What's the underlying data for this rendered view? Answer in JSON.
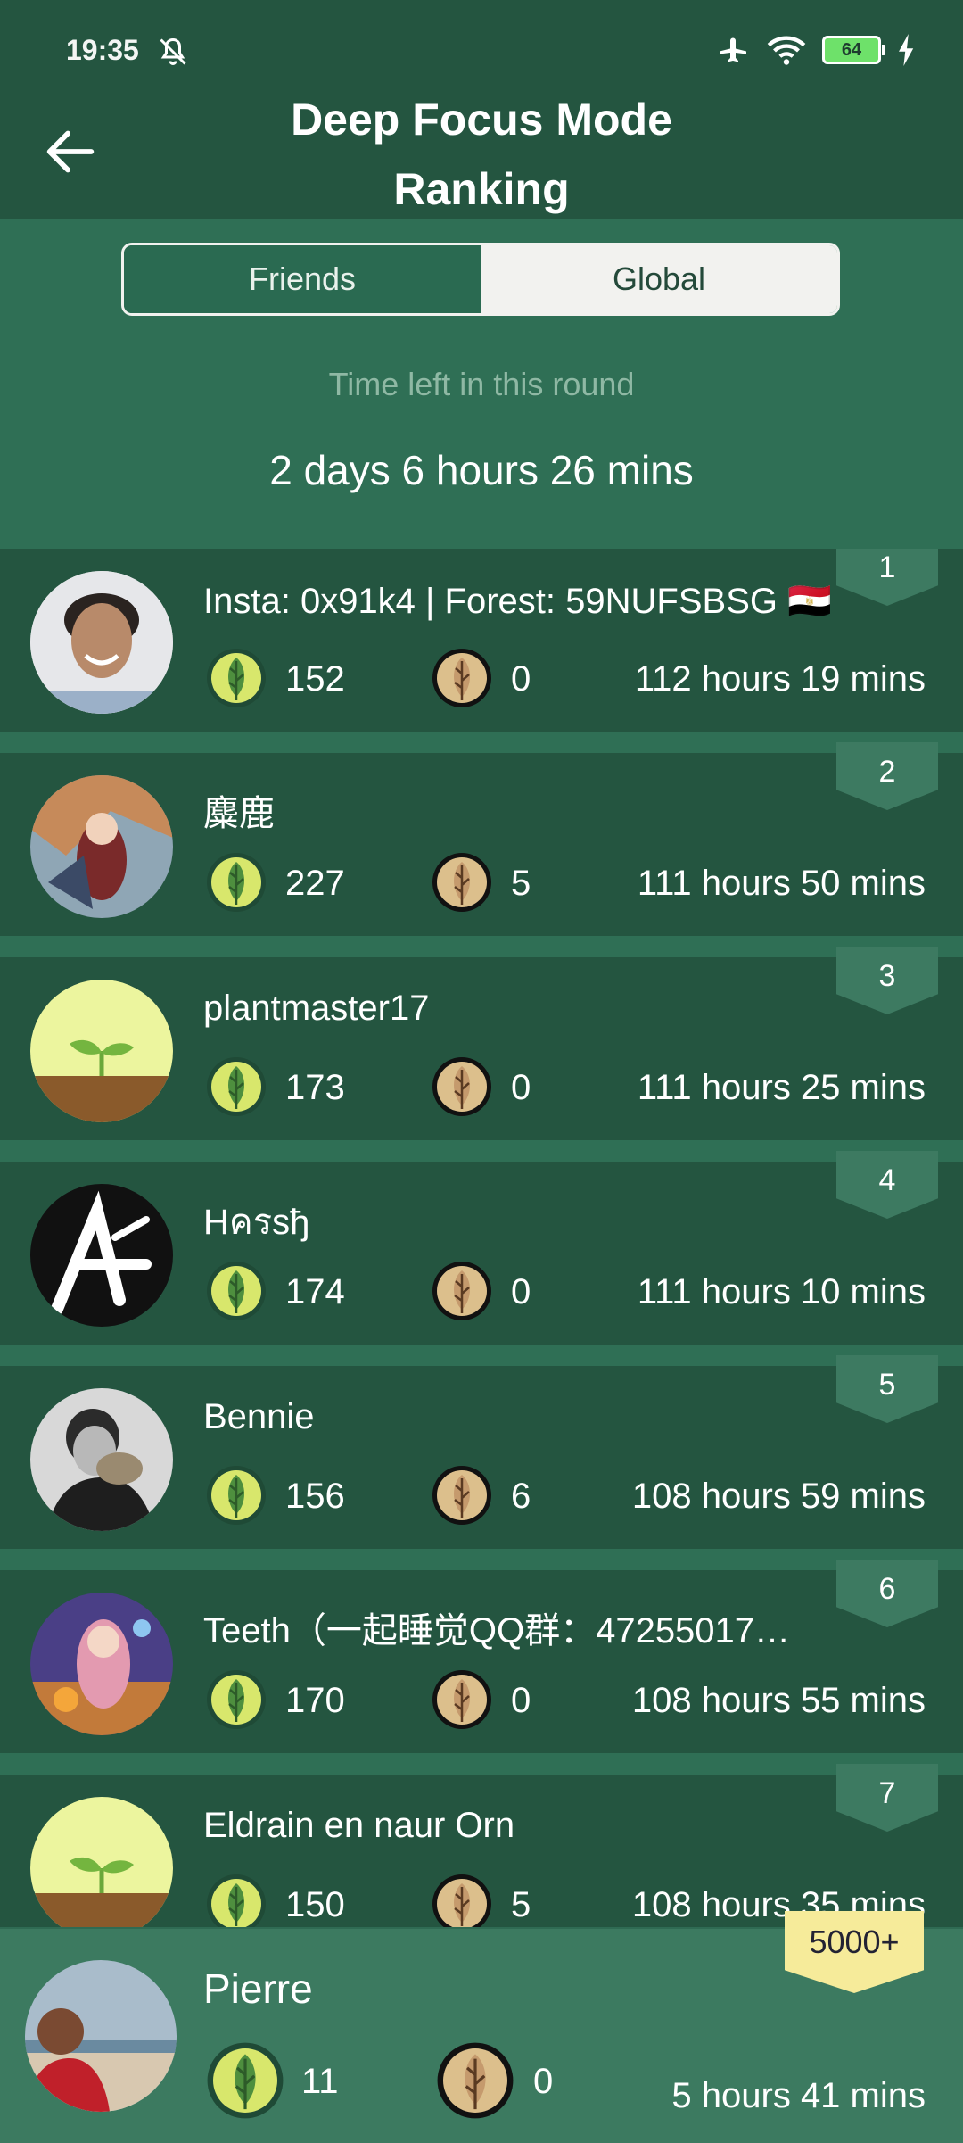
{
  "status_bar": {
    "time": "19:35",
    "battery": "64",
    "icons": [
      "bell-off-icon",
      "airplane-icon",
      "wifi-icon",
      "battery-icon",
      "charging-icon"
    ]
  },
  "header": {
    "title_line1": "Deep Focus Mode",
    "title_line2": "Ranking",
    "back_icon": "arrow-left-icon"
  },
  "tabs": {
    "friends": "Friends",
    "global": "Global",
    "selected": "global"
  },
  "round": {
    "label": "Time left in this round",
    "value": "2 days 6 hours 26 mins"
  },
  "rankings": [
    {
      "rank": "1",
      "name": "Insta: 0x91k4 | Forest: 59NUFSBSG 🇪🇬",
      "green": "152",
      "brown": "0",
      "time": "112 hours 19 mins",
      "avatar": "photo-man"
    },
    {
      "rank": "2",
      "name": "麋鹿",
      "green": "227",
      "brown": "5",
      "time": "111 hours 50 mins",
      "avatar": "anime-art"
    },
    {
      "rank": "3",
      "name": "plantmaster17",
      "green": "173",
      "brown": "0",
      "time": "111 hours 25 mins",
      "avatar": "sprout"
    },
    {
      "rank": "4",
      "name": "Hครsђ",
      "green": "174",
      "brown": "0",
      "time": "111 hours 10 mins",
      "avatar": "letter-a"
    },
    {
      "rank": "5",
      "name": "Bennie",
      "green": "156",
      "brown": "6",
      "time": "108 hours 59 mins",
      "avatar": "photo-bw"
    },
    {
      "rank": "6",
      "name": "Teeth（一起睡觉QQ群：47255017…",
      "green": "170",
      "brown": "0",
      "time": "108 hours 55 mins",
      "avatar": "anime-girl"
    },
    {
      "rank": "7",
      "name": "Eldrain en naur Orn",
      "green": "150",
      "brown": "5",
      "time": "108 hours 35 mins",
      "avatar": "sprout"
    }
  ],
  "me": {
    "rank": "5000+",
    "name": "Pierre",
    "green": "11",
    "brown": "0",
    "time": "5 hours 41 mins",
    "avatar": "photo-beach"
  },
  "colors": {
    "header": "#245540",
    "background": "#2f6f55",
    "row": "#245540",
    "accent_yellow": "#f6eb9a",
    "green_coin": "#d6e56a",
    "brown_coin": "#d8b887"
  }
}
